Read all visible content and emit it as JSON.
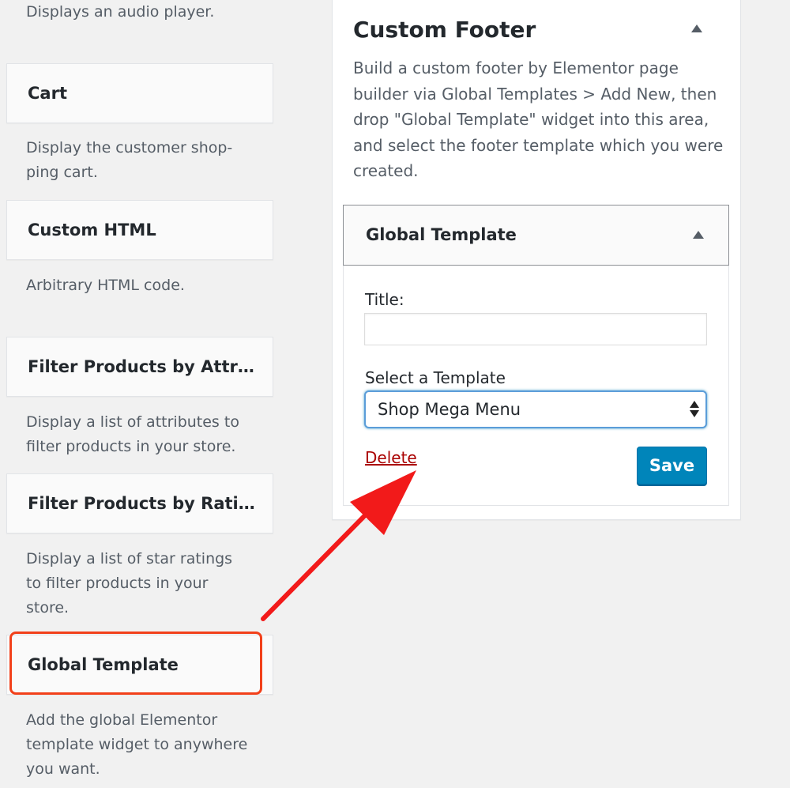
{
  "available_widgets": {
    "audio_desc": "Displays an audio player.",
    "items": [
      {
        "title": "Cart",
        "description": "Display the customer shop-\nping cart."
      },
      {
        "title": "Custom HTML",
        "description": "Arbitrary HTML code."
      },
      {
        "title": "Filter Products by Attrib…",
        "description": "Display a list of attributes to filter products in your store."
      },
      {
        "title": "Filter Products by Rating",
        "description": "Display a list of star ratings to filter products in your store."
      },
      {
        "title": "Global Template",
        "description": "Add the global Elementor template widget to anywhere you want."
      }
    ]
  },
  "sidebar_area": {
    "title": "Custom Footer",
    "description": "Build a custom footer by Elementor page builder via Global Templates > Add New, then drop \"Global Template\" widget into this area, and select the footer template which you were created."
  },
  "widget_panel": {
    "title": "Global Template",
    "title_label": "Title:",
    "title_value": "",
    "template_label": "Select a Template",
    "template_value": "Shop Mega Menu",
    "delete_label": "Delete",
    "save_label": "Save"
  },
  "colors": {
    "annotation_red": "#f2401a",
    "save_blue": "#0085ba",
    "delete_red": "#aa0000"
  }
}
